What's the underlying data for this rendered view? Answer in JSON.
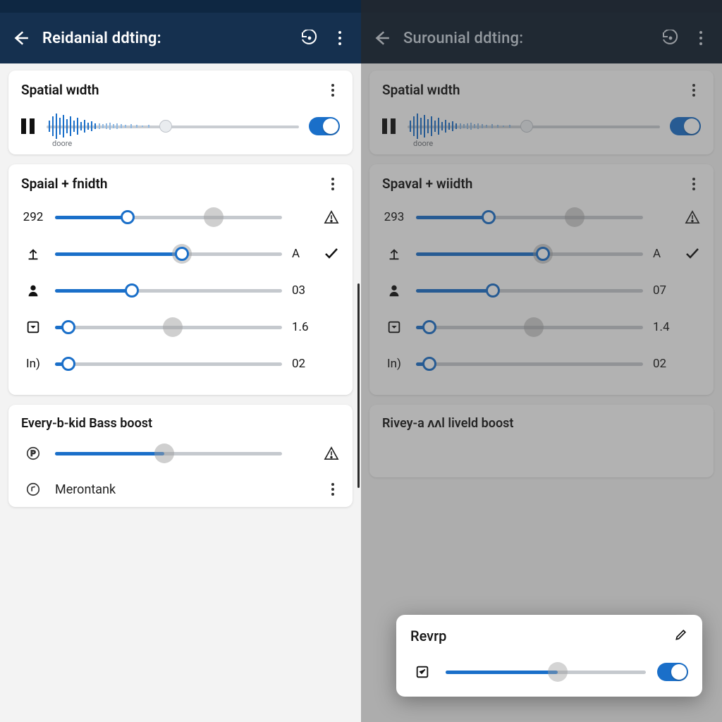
{
  "left": {
    "appbar_title": "Reidanial ddting:",
    "card1": {
      "title": "Spatial wıdth",
      "caption": "doore"
    },
    "card2": {
      "title": "Spaial + fnidth",
      "rows": [
        {
          "left": "292",
          "fill": 32,
          "ghost": 70,
          "right": "",
          "extra": "warn"
        },
        {
          "left": "up-icon",
          "fill": 56,
          "ghost": 56,
          "right": "A",
          "extra": "check"
        },
        {
          "left": "person-icon",
          "fill": 34,
          "ghost": null,
          "right": "03",
          "extra": ""
        },
        {
          "left": "box-icon",
          "fill": 6,
          "ghost": 52,
          "right": "1.6",
          "extra": ""
        },
        {
          "left": "In)",
          "fill": 6,
          "ghost": null,
          "right": "02",
          "extra": ""
        }
      ]
    },
    "card3": {
      "title": "Every-b-kid Bass boost",
      "p_row": {
        "fill": 48
      },
      "line2": "Merontank"
    }
  },
  "right": {
    "appbar_title": "Surounial ddting:",
    "card1": {
      "title": "Spatial wıdth",
      "caption": "doore"
    },
    "card2": {
      "title": "Spaval + wiidth",
      "rows": [
        {
          "left": "293",
          "fill": 32,
          "ghost": 70,
          "right": "",
          "extra": "warn"
        },
        {
          "left": "up-icon",
          "fill": 56,
          "ghost": 56,
          "right": "A",
          "extra": "check"
        },
        {
          "left": "person-icon",
          "fill": 34,
          "ghost": null,
          "right": "07",
          "extra": ""
        },
        {
          "left": "box-icon",
          "fill": 6,
          "ghost": 52,
          "right": "1.4",
          "extra": ""
        },
        {
          "left": "In)",
          "fill": 6,
          "ghost": null,
          "right": "02",
          "extra": ""
        }
      ]
    },
    "card3": {
      "title": "Rivey-a ʌʌl liveld boost"
    },
    "popup": {
      "title": "Revrp",
      "fill": 56
    }
  }
}
